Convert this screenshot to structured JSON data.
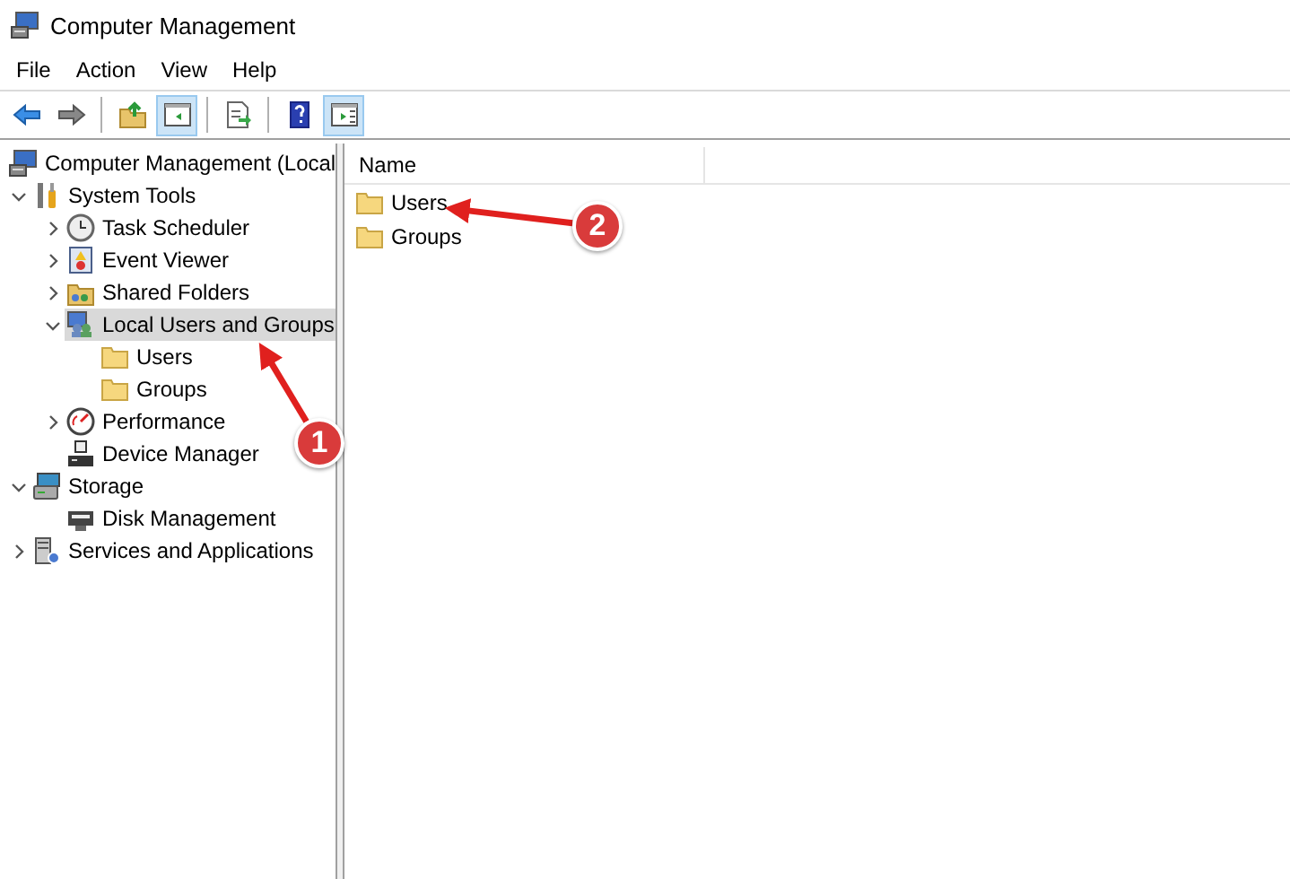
{
  "window": {
    "title": "Computer Management"
  },
  "menu": [
    "File",
    "Action",
    "View",
    "Help"
  ],
  "toolbar": [
    [
      {
        "pressed": false
      },
      {
        "pressed": false
      }
    ],
    [
      {
        "pressed": false
      },
      {
        "pressed": true
      }
    ],
    [
      {
        "pressed": false
      }
    ],
    [
      {
        "pressed": false
      },
      {
        "pressed": true
      }
    ]
  ],
  "tree": [
    {
      "label": "Computer Management (Local",
      "kind": "computer",
      "selected": false,
      "children": [
        {
          "label": "System Tools",
          "kind": "tools",
          "selected": false,
          "expanded": true,
          "children": [
            {
              "label": "Task Scheduler",
              "kind": "clock",
              "selected": false,
              "expanded": false,
              "has_children": true
            },
            {
              "label": "Event Viewer",
              "kind": "event",
              "selected": false,
              "expanded": false,
              "has_children": true
            },
            {
              "label": "Shared Folders",
              "kind": "share",
              "selected": false,
              "expanded": false,
              "has_children": true
            },
            {
              "label": "Local Users and Groups",
              "kind": "users",
              "selected": true,
              "expanded": true,
              "children": [
                {
                  "label": "Users",
                  "kind": "folder",
                  "selected": false
                },
                {
                  "label": "Groups",
                  "kind": "folder",
                  "selected": false
                }
              ]
            },
            {
              "label": "Performance",
              "kind": "perf",
              "selected": false,
              "expanded": false,
              "has_children": true
            },
            {
              "label": "Device Manager",
              "kind": "device",
              "selected": false
            }
          ]
        },
        {
          "label": "Storage",
          "kind": "storage",
          "selected": false,
          "expanded": true,
          "children": [
            {
              "label": "Disk Management",
              "kind": "disk",
              "selected": false
            }
          ]
        },
        {
          "label": "Services and Applications",
          "kind": "services",
          "selected": false,
          "expanded": false,
          "has_children": true
        }
      ]
    }
  ],
  "list": {
    "columns": [
      "Name"
    ],
    "rows": [
      {
        "name": "Users"
      },
      {
        "name": "Groups"
      }
    ]
  },
  "annotations": [
    {
      "label": "1"
    },
    {
      "label": "2"
    }
  ]
}
